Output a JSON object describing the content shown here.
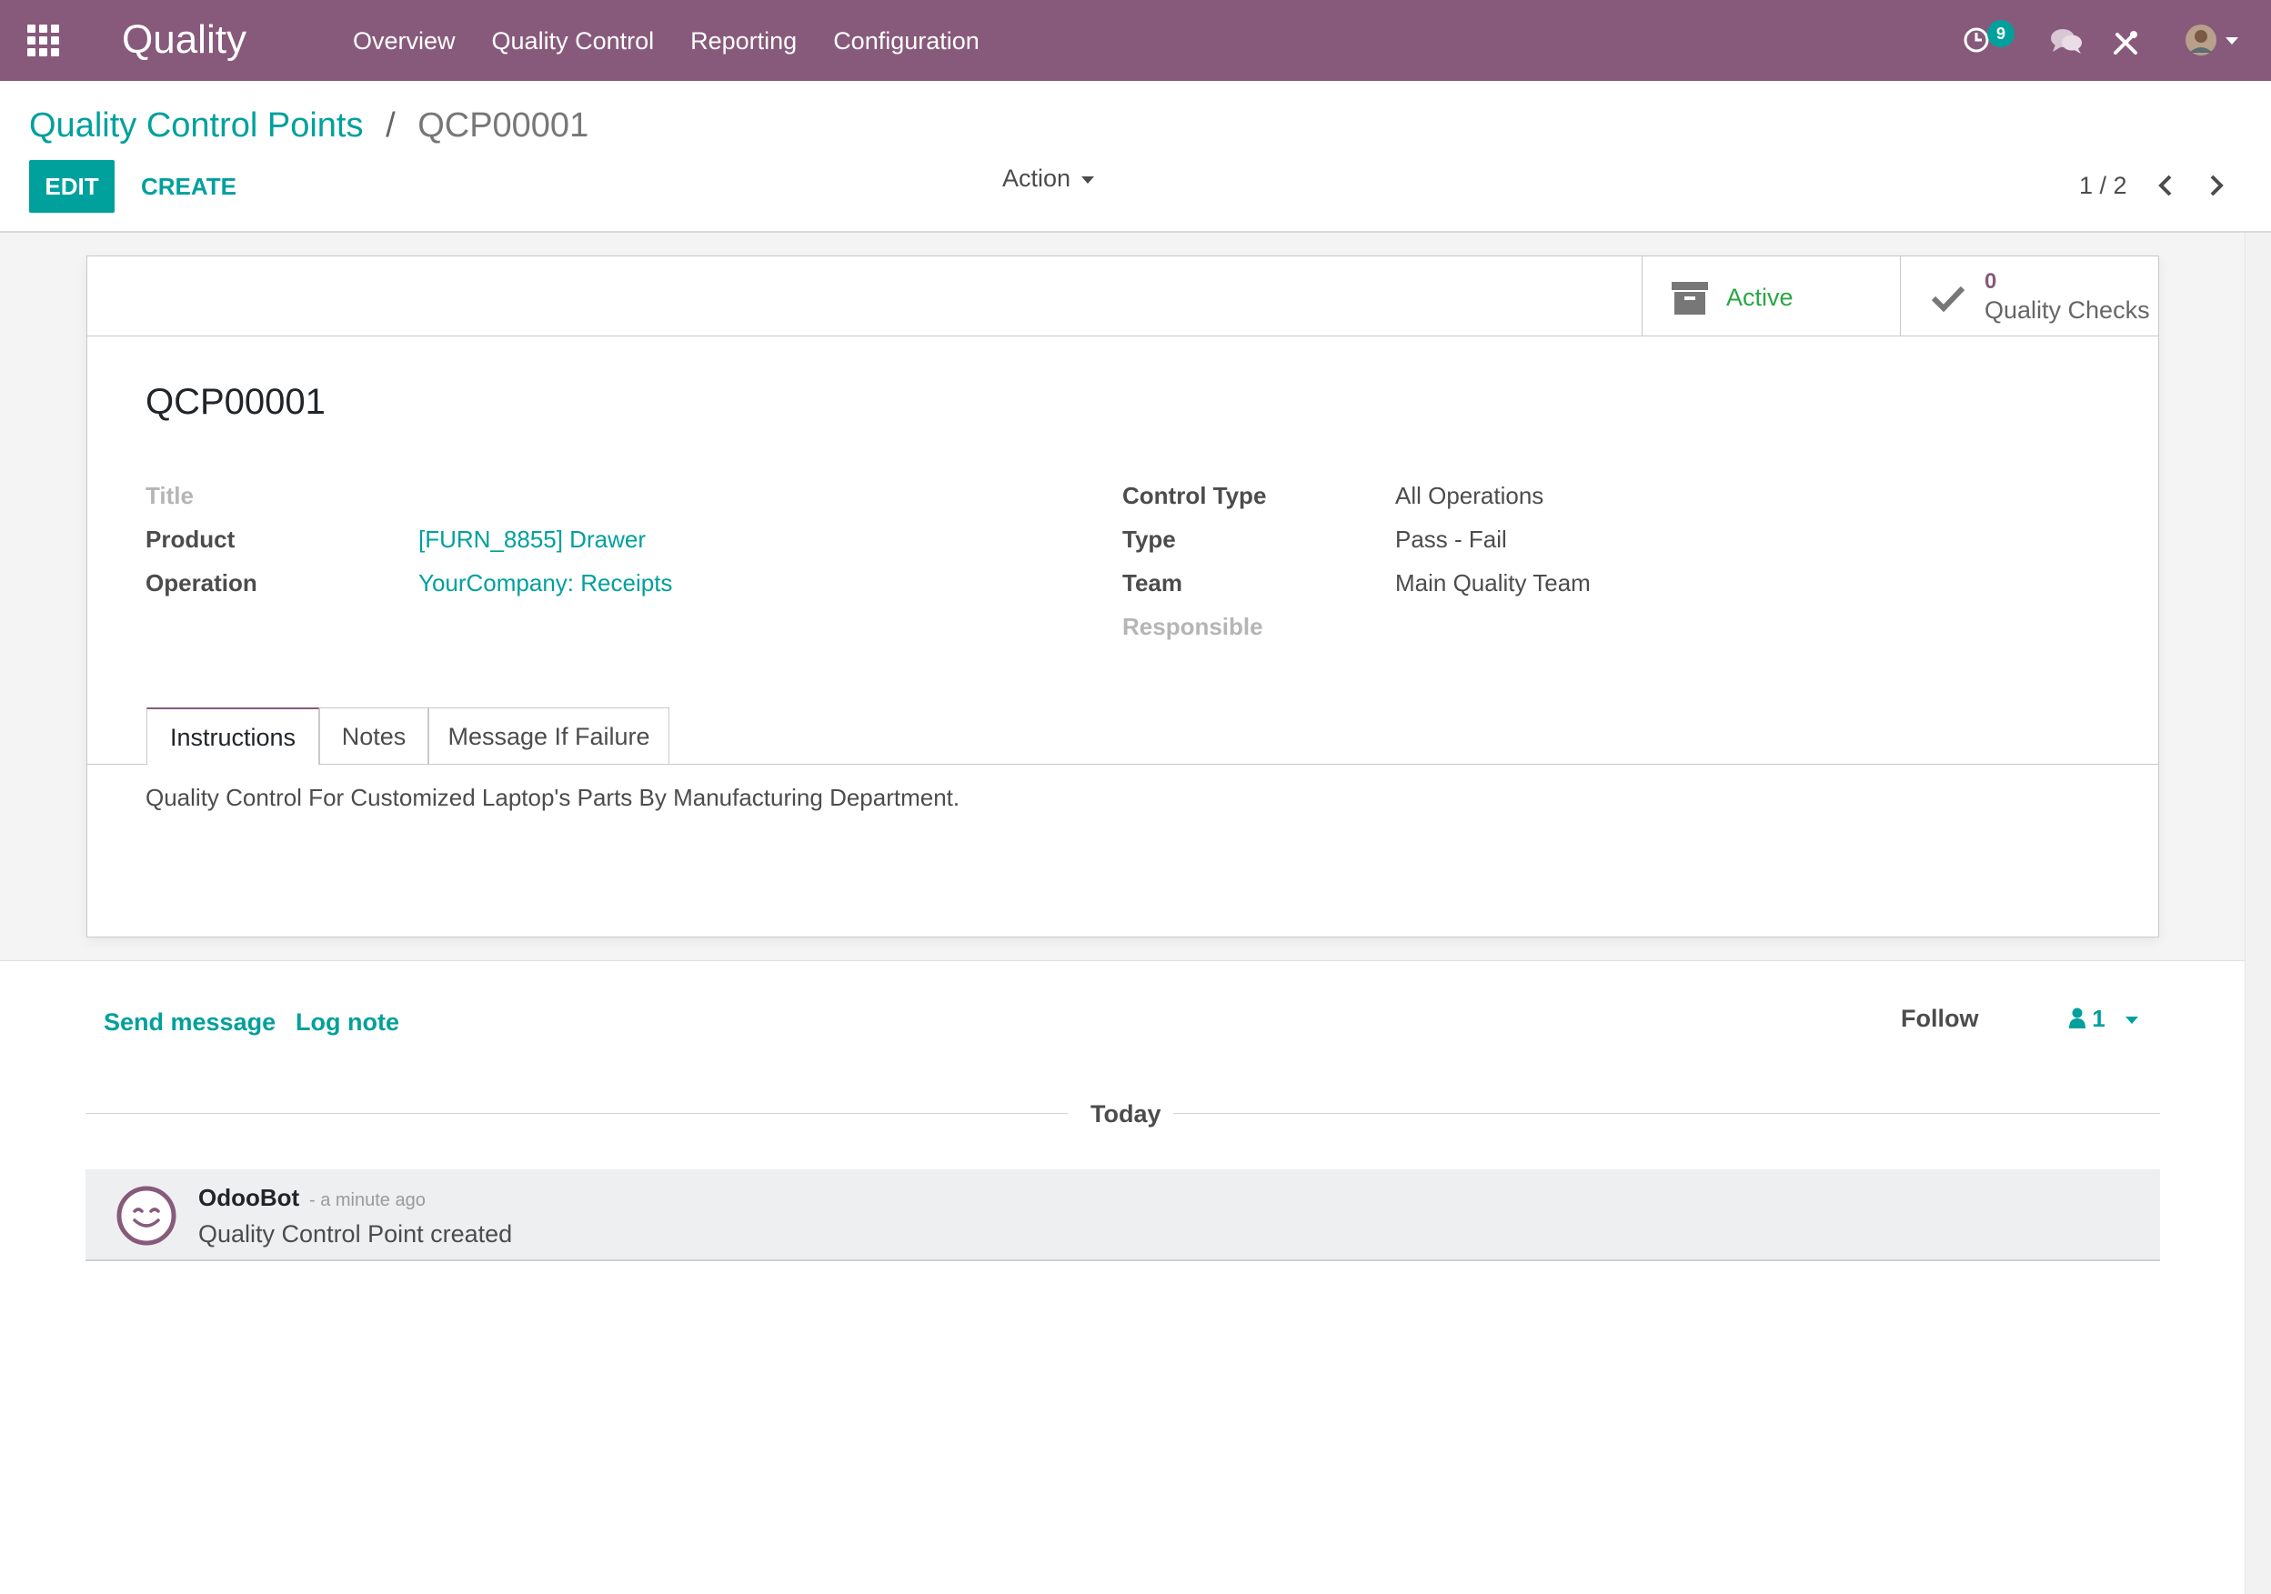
{
  "navbar": {
    "brand": "Quality",
    "menu": [
      "Overview",
      "Quality Control",
      "Reporting",
      "Configuration"
    ],
    "activity_count": "9",
    "icons": [
      "apps-grid-icon",
      "activity-clock-icon",
      "chat-bubbles-icon",
      "debug-tools-icon",
      "user-avatar"
    ]
  },
  "breadcrumb": {
    "parent": "Quality Control Points",
    "separator": "/",
    "current": "QCP00001"
  },
  "toolbar": {
    "edit": "EDIT",
    "create": "CREATE",
    "action": "Action"
  },
  "pager": {
    "value": "1 / 2"
  },
  "button_box": {
    "active_label": "Active",
    "checks_count": "0",
    "checks_label": "Quality Checks"
  },
  "record": {
    "name": "QCP00001",
    "left_fields": [
      {
        "label": "Title",
        "value": ""
      },
      {
        "label": "Product",
        "value": "[FURN_8855] Drawer"
      },
      {
        "label": "Operation",
        "value": "YourCompany: Receipts"
      }
    ],
    "right_fields": [
      {
        "label": "Control Type",
        "value": "All Operations"
      },
      {
        "label": "Type",
        "value": "Pass - Fail"
      },
      {
        "label": "Team",
        "value": "Main Quality Team"
      },
      {
        "label": "Responsible",
        "value": ""
      }
    ]
  },
  "tabs": [
    "Instructions",
    "Notes",
    "Message If Failure"
  ],
  "instructions": "Quality Control For Customized Laptop's Parts By Manufacturing Department.",
  "chatter": {
    "send_message": "Send message",
    "log_note": "Log note",
    "follow": "Follow",
    "followers_count": "1",
    "date_separator": "Today",
    "messages": [
      {
        "author": "OdooBot",
        "date": "- a minute ago",
        "body": "Quality Control Point created"
      }
    ]
  },
  "colors": {
    "brand": "#875a7b",
    "accent": "#00a09d",
    "active": "#28a745"
  }
}
